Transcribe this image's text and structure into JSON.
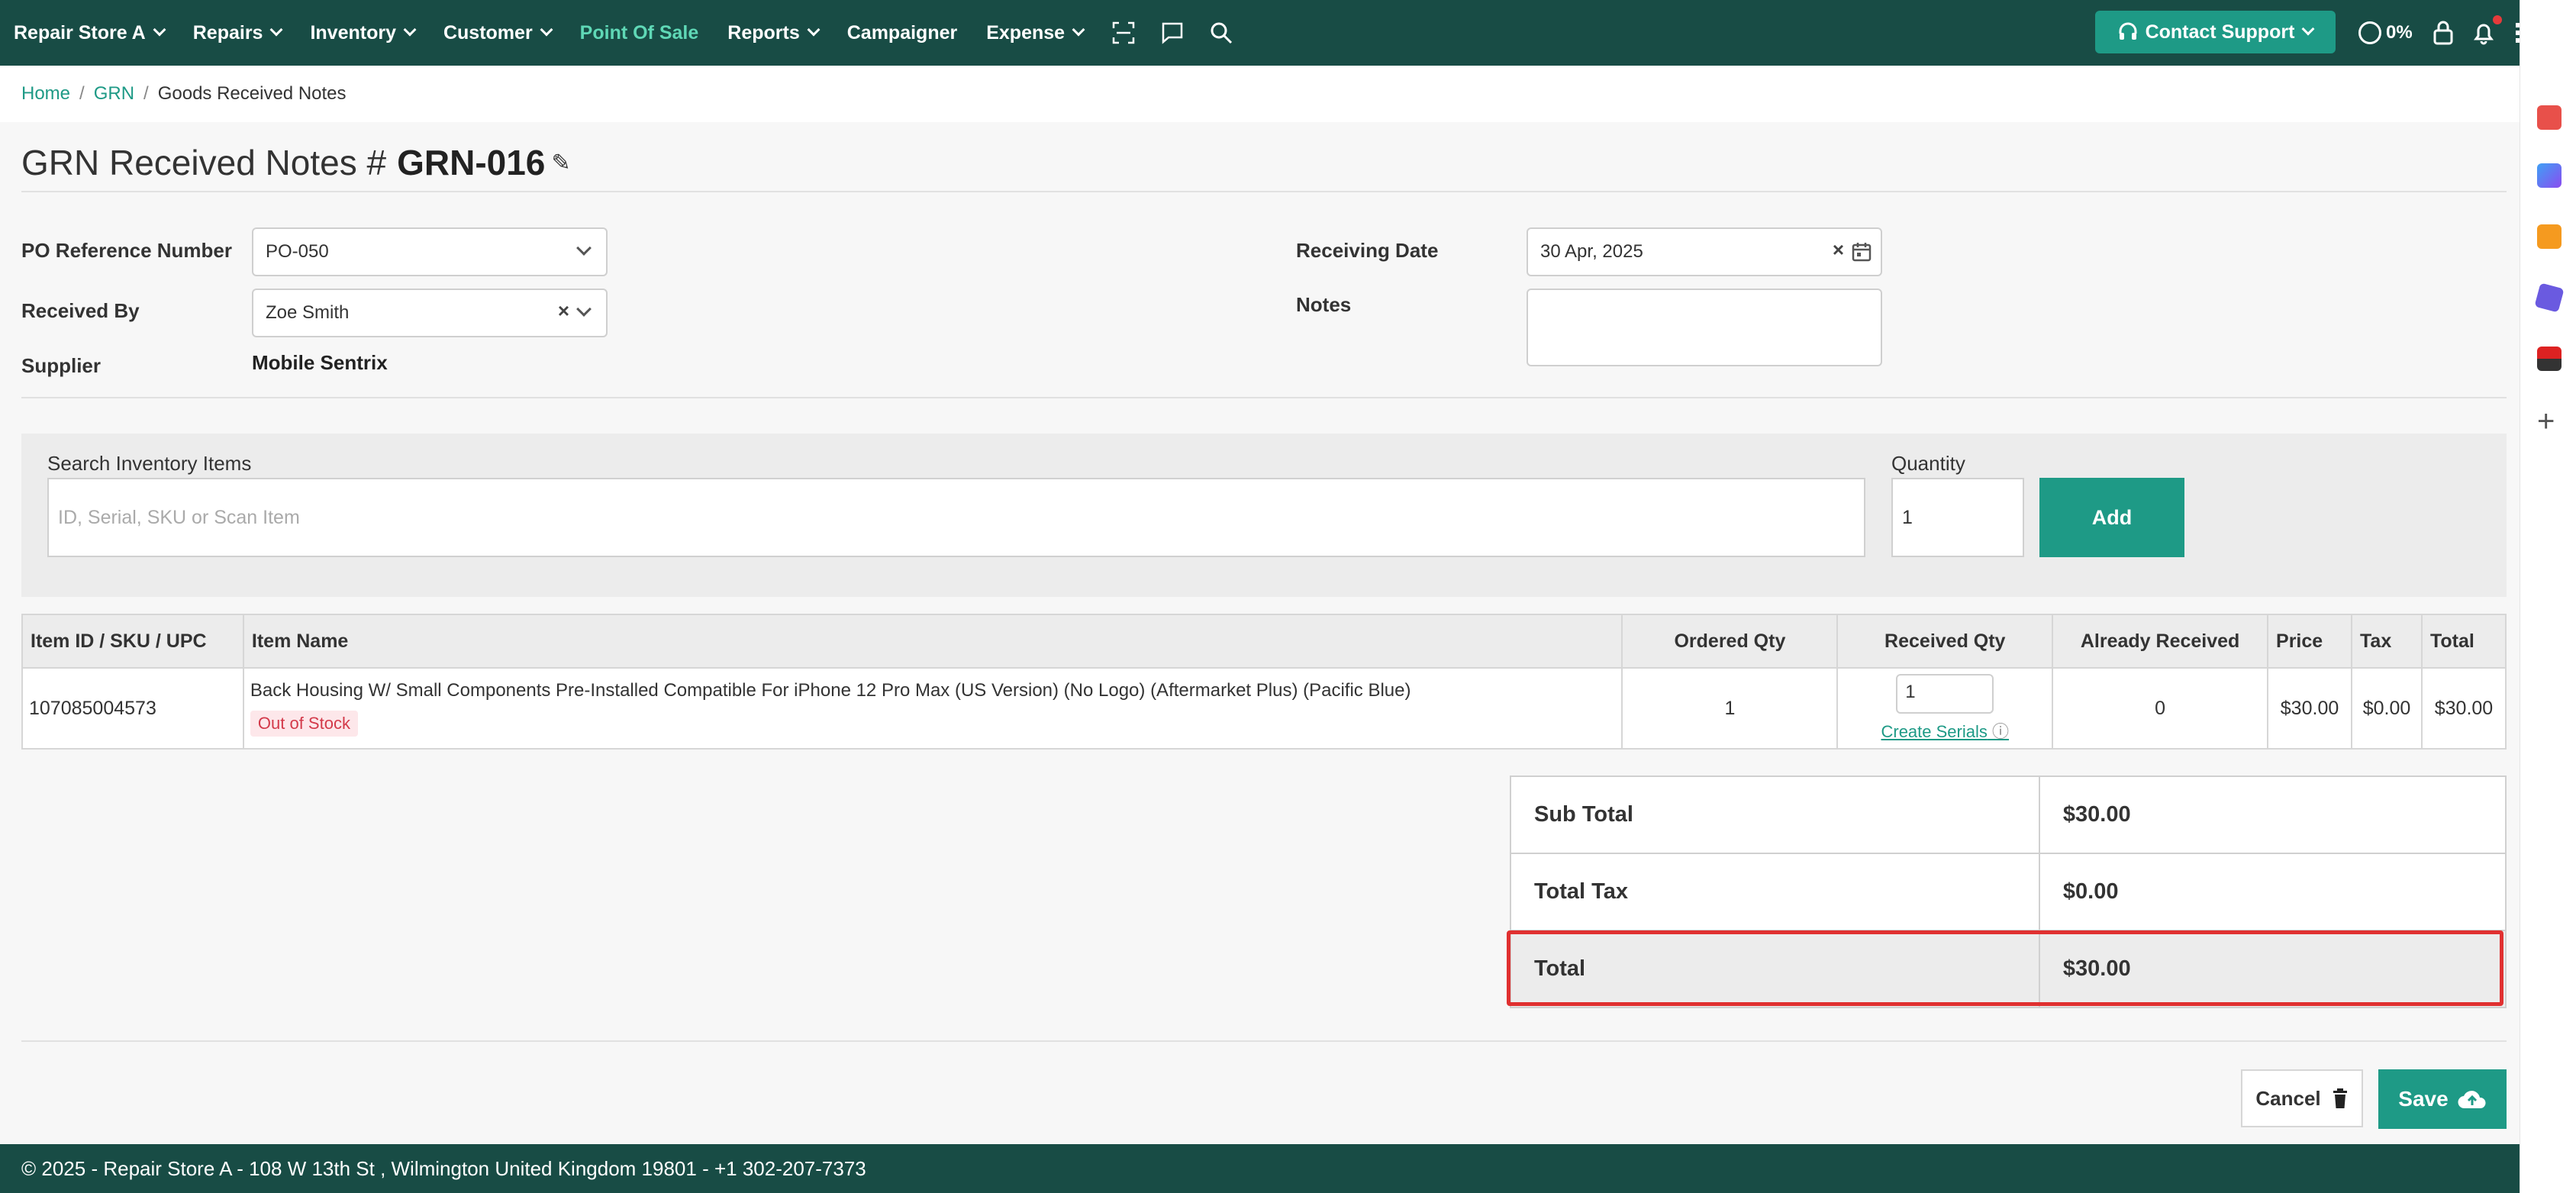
{
  "nav": {
    "store": "Repair Store A",
    "items": [
      {
        "label": "Repairs",
        "dropdown": true
      },
      {
        "label": "Inventory",
        "dropdown": true
      },
      {
        "label": "Customer",
        "dropdown": true
      },
      {
        "label": "Point Of Sale",
        "dropdown": false
      },
      {
        "label": "Reports",
        "dropdown": true
      },
      {
        "label": "Campaigner",
        "dropdown": false
      },
      {
        "label": "Expense",
        "dropdown": true
      }
    ],
    "support_label": "Contact Support",
    "progress": "0%",
    "accent_color": "#5fd8b6",
    "bar_color": "#184c45",
    "button_color": "#1e9a86"
  },
  "breadcrumb": {
    "home": "Home",
    "grn": "GRN",
    "current": "Goods Received Notes"
  },
  "page": {
    "title_prefix": "GRN Received Notes #",
    "grn_number": "GRN-016"
  },
  "form": {
    "po_label": "PO Reference Number",
    "po_value": "PO-050",
    "received_by_label": "Received By",
    "received_by_value": "Zoe Smith",
    "supplier_label": "Supplier",
    "supplier_value": "Mobile Sentrix",
    "receiving_date_label": "Receiving Date",
    "receiving_date_value": "30 Apr, 2025",
    "notes_label": "Notes"
  },
  "search": {
    "label": "Search Inventory Items",
    "placeholder": "ID, Serial, SKU or Scan Item",
    "quantity_label": "Quantity",
    "quantity_value": "1",
    "add_label": "Add"
  },
  "table": {
    "headers": [
      "Item ID / SKU / UPC",
      "Item Name",
      "Ordered Qty",
      "Received Qty",
      "Already Received",
      "Price",
      "Tax",
      "Total"
    ],
    "rows": [
      {
        "id": "107085004573",
        "name": "Back Housing W/ Small Components Pre-Installed Compatible For iPhone 12 Pro Max (US Version) (No Logo) (Aftermarket Plus) (Pacific Blue)",
        "stock_badge": "Out of Stock",
        "ordered": "1",
        "received": "1",
        "serial_link": "Create Serials",
        "already": "0",
        "price": "$30.00",
        "tax": "$0.00",
        "total": "$30.00"
      }
    ]
  },
  "totals": {
    "sub_total_label": "Sub Total",
    "sub_total": "$30.00",
    "tax_label": "Total Tax",
    "tax": "$0.00",
    "total_label": "Total",
    "total": "$30.00"
  },
  "actions": {
    "cancel": "Cancel",
    "save": "Save"
  },
  "footer": "© 2025 - Repair Store A - 108 W 13th St , Wilmington United Kingdom 19801 - +1 302-207-7373"
}
